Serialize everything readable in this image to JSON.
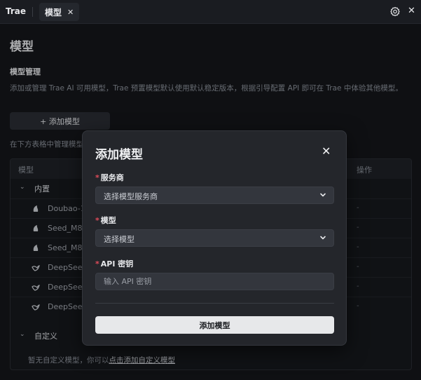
{
  "topbar": {
    "brand": "Trae",
    "tab_label": "模型",
    "tab_close": "✕",
    "settings_icon": "gear-icon",
    "close_glyph": "✕"
  },
  "page": {
    "title": "模型",
    "section_title": "模型管理",
    "description": "添加或管理 Trae AI 可用模型，Trae 预置模型默认使用默认稳定版本，根据引导配置 API 即可在 Trae 中体验其他模型。",
    "add_button": "+ 添加模型",
    "table_hint": "在下方表格中管理模型"
  },
  "table": {
    "header_model": "模型",
    "header_ops": "操作",
    "groups": [
      {
        "label": "内置",
        "rows": [
          {
            "name": "Doubao-1.5-pro",
            "icon": "doubao-icon",
            "ops": "-"
          },
          {
            "name": "Seed_M8",
            "icon": "doubao-icon",
            "ops": "-"
          },
          {
            "name": "Seed_M8",
            "icon": "doubao-icon",
            "ops": "-"
          },
          {
            "name": "DeepSeek",
            "icon": "deepseek-icon",
            "ops": "-"
          },
          {
            "name": "DeepSeek",
            "icon": "deepseek-icon",
            "ops": "-"
          },
          {
            "name": "DeepSeek",
            "icon": "deepseek-icon",
            "ops": "-"
          }
        ]
      },
      {
        "label": "自定义",
        "rows": []
      }
    ],
    "empty_text": "暂无自定义模型，你可以",
    "empty_link": "点击添加自定义模型"
  },
  "modal": {
    "title": "添加模型",
    "close_glyph": "✕",
    "provider_label": "服务商",
    "provider_placeholder": "选择模型服务商",
    "model_label": "模型",
    "model_placeholder": "选择模型",
    "api_label": "API 密钥",
    "api_placeholder": "输入 API 密钥",
    "submit_label": "添加模型",
    "required_mark": "*"
  },
  "colors": {
    "background": "#14161a",
    "modal": "#24262b",
    "required": "#e04b5a",
    "primary_button": "#e7e8ea"
  }
}
